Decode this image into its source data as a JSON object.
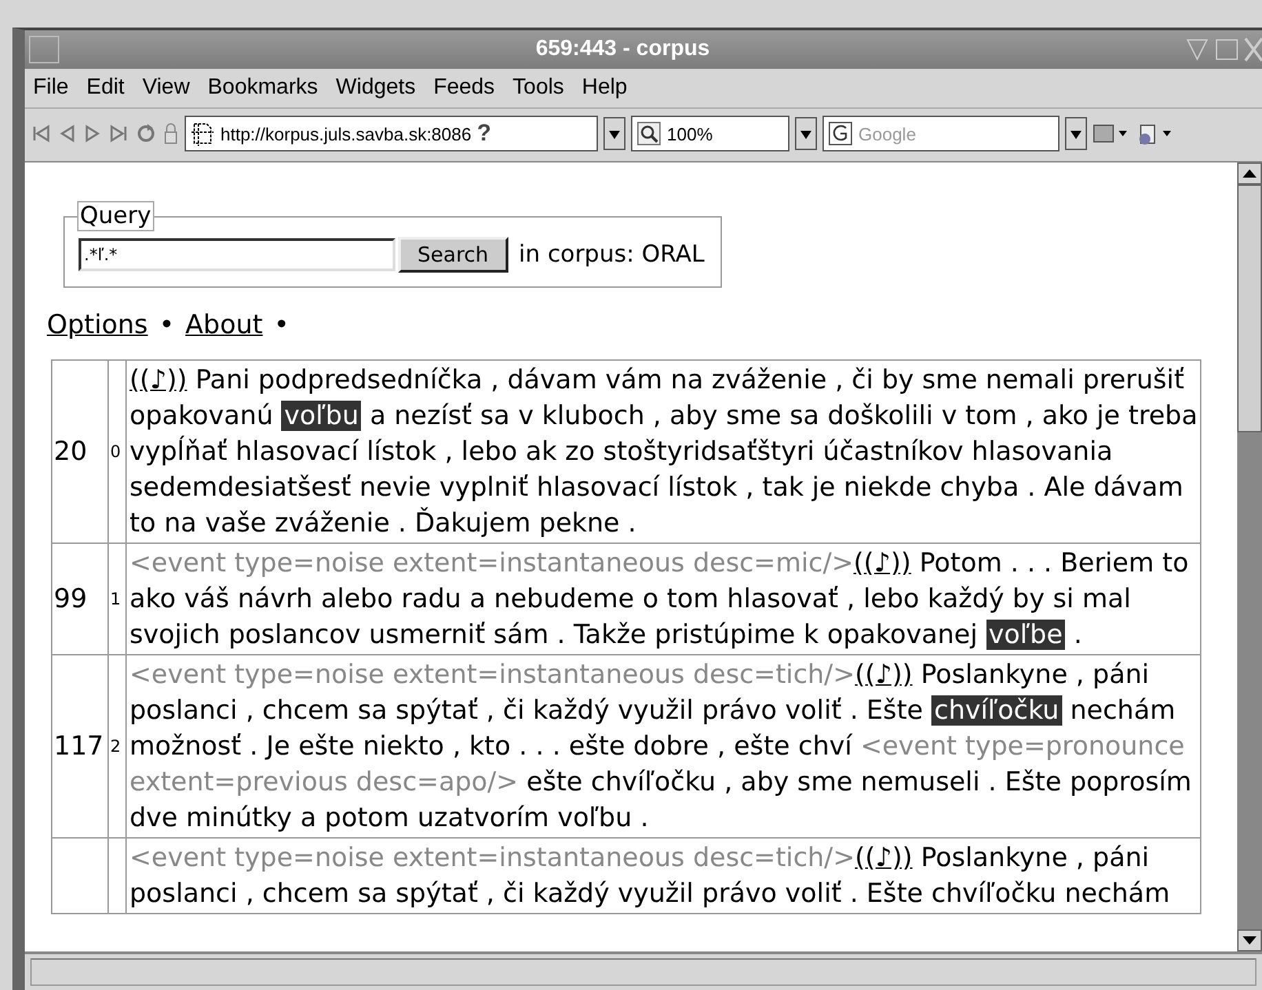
{
  "window": {
    "title": "659:443 - corpus"
  },
  "menu": [
    "File",
    "Edit",
    "View",
    "Bookmarks",
    "Widgets",
    "Feeds",
    "Tools",
    "Help"
  ],
  "toolbar": {
    "url": "http://korpus.juls.savba.sk:8086",
    "help": "?",
    "zoom": "100%",
    "search_placeholder": "Google"
  },
  "query": {
    "legend": "Query",
    "value": ".*ľ.*",
    "button": "Search",
    "corpus_label": "in corpus: ORAL"
  },
  "links": [
    {
      "label": "Options"
    },
    {
      "label": "About"
    }
  ],
  "separator": "•",
  "results": [
    {
      "number": "20",
      "index": "0",
      "lines": [
        [
          {
            "kind": "sound",
            "text": "((♪))"
          },
          {
            "kind": "text",
            "text": " Pani podpredsedníčka , dávam vám na zváženie , či by sme nemali prerušiť"
          }
        ],
        [
          {
            "kind": "text",
            "text": "opakovanú "
          },
          {
            "kind": "hit",
            "text": "voľbu"
          },
          {
            "kind": "text",
            "text": " a nezísť sa v kluboch , aby sme sa doškolili v tom , ako je treba"
          }
        ],
        [
          {
            "kind": "text",
            "text": "vypĺňať hlasovací lístok , lebo ak zo stoštyridsaťštyri účastníkov hlasovania"
          }
        ],
        [
          {
            "kind": "text",
            "text": "sedemdesiatšesť nevie vyplniť hlasovací lístok , tak je niekde chyba . Ale dávam"
          }
        ],
        [
          {
            "kind": "text",
            "text": "to na vaše zváženie . Ďakujem pekne ."
          }
        ]
      ]
    },
    {
      "number": "99",
      "index": "1",
      "lines": [
        [
          {
            "kind": "event",
            "text": "<event type=noise extent=instantaneous desc=mic/>"
          },
          {
            "kind": "sound",
            "text": "((♪))"
          },
          {
            "kind": "text",
            "text": " Potom . . . Beriem to"
          }
        ],
        [
          {
            "kind": "text",
            "text": "ako váš návrh alebo radu a nebudeme o tom hlasovať , lebo každý by si mal"
          }
        ],
        [
          {
            "kind": "text",
            "text": "svojich poslancov usmerniť sám . Takže pristúpime k opakovanej "
          },
          {
            "kind": "hit",
            "text": "voľbe"
          },
          {
            "kind": "text",
            "text": " ."
          }
        ]
      ]
    },
    {
      "number": "117",
      "index": "2",
      "lines": [
        [
          {
            "kind": "event",
            "text": "<event type=noise extent=instantaneous desc=tich/>"
          },
          {
            "kind": "sound",
            "text": "((♪))"
          },
          {
            "kind": "text",
            "text": " Poslankyne , páni"
          }
        ],
        [
          {
            "kind": "text",
            "text": "poslanci , chcem sa spýtať , či každý využil právo voliť . Ešte "
          },
          {
            "kind": "hit",
            "text": "chvíľočku"
          },
          {
            "kind": "text",
            "text": " nechám"
          }
        ],
        [
          {
            "kind": "text",
            "text": "možnosť . Je ešte niekto , kto . . . ešte dobre , ešte chví "
          },
          {
            "kind": "event",
            "text": "<event type=pronounce"
          }
        ],
        [
          {
            "kind": "event",
            "text": "extent=previous desc=apo/>"
          },
          {
            "kind": "text",
            "text": " ešte chvíľočku , aby sme nemuseli . Ešte poprosím"
          }
        ],
        [
          {
            "kind": "text",
            "text": "dve minútky a potom uzatvorím voľbu ."
          }
        ]
      ]
    },
    {
      "lines": [
        [
          {
            "kind": "event",
            "text": "<event type=noise extent=instantaneous desc=tich/>"
          },
          {
            "kind": "sound",
            "text": "((♪))"
          },
          {
            "kind": "text",
            "text": " Poslankyne , páni"
          }
        ],
        [
          {
            "kind": "text",
            "text": "poslanci , chcem sa spýtať , či každý využil právo voliť . Ešte chvíľočku nechám"
          }
        ]
      ]
    }
  ]
}
